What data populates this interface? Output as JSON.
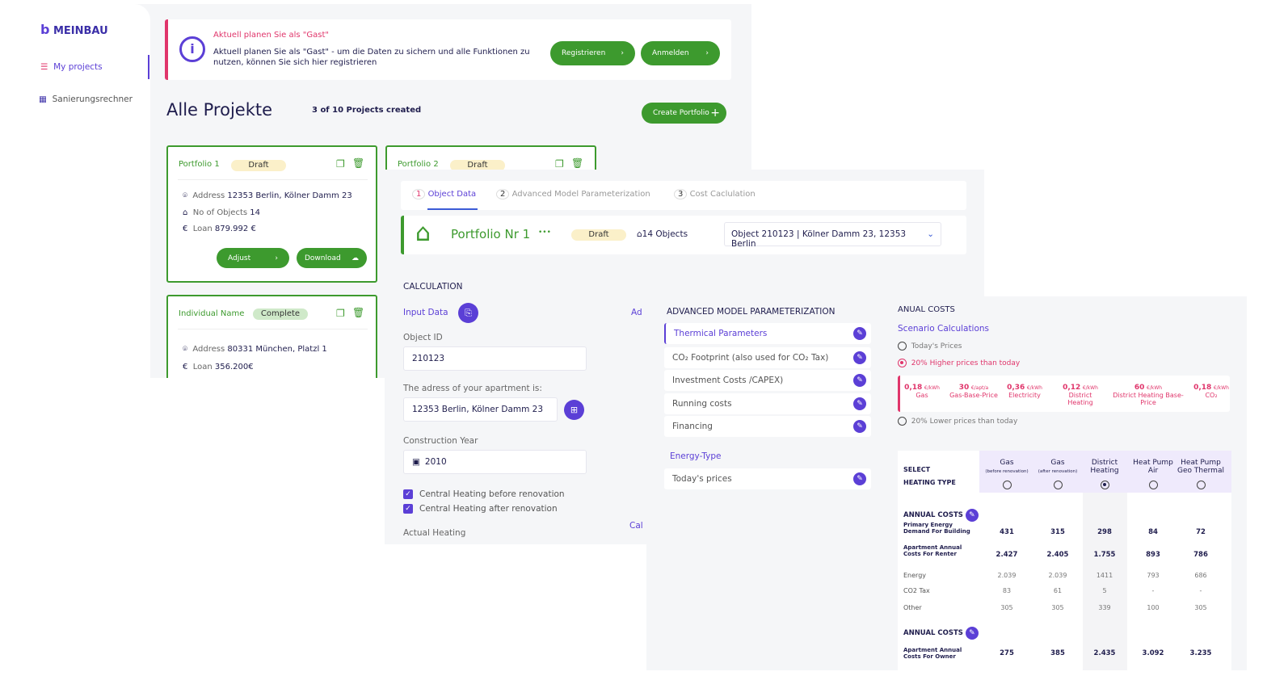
{
  "colors": {
    "green": "#3d9a2e",
    "purple": "#5b3fd6",
    "pink": "#e0356b",
    "navy": "#1f1d4d"
  },
  "sidebar": {
    "logo": "MEINBAU",
    "items": [
      {
        "label": "My projects",
        "icon": "list-icon",
        "active": true
      },
      {
        "label": "Sanierungsrechner",
        "icon": "calculator-icon"
      }
    ]
  },
  "banner": {
    "title": "Aktuell planen Sie als \"Gast\"",
    "text": "Aktuell planen Sie als \"Gast\" - um die Daten zu sichern und alle Funktionen zu nutzen, können Sie sich hier registrieren",
    "register": "Registrieren",
    "login": "Anmelden"
  },
  "projects": {
    "title": "Alle Projekte",
    "count": "3 of 10 Projects created",
    "create": "Create Portfolio",
    "cards": [
      {
        "name": "Portfolio 1",
        "status": "Draft",
        "address_label": "Address",
        "address": "12353 Berlin, Kölner Damm 23",
        "objects_label": "No of Objects",
        "objects": "14",
        "loan_label": "Loan",
        "loan": "879.992 €",
        "adjust": "Adjust",
        "download": "Download"
      },
      {
        "name": "Portfolio 2",
        "status": "Draft"
      },
      {
        "name": "Individual Name",
        "status": "Complete",
        "address_label": "Address",
        "address": "80331 München, Platzl 1",
        "loan_label": "Loan",
        "loan": "356.200€"
      }
    ]
  },
  "wizard": {
    "steps": [
      {
        "num": "1",
        "label": "Object Data",
        "active": true
      },
      {
        "num": "2",
        "label": "Advanced Model Parameterization"
      },
      {
        "num": "3",
        "label": "Cost Caclulation"
      }
    ],
    "portfolio": "Portfolio Nr 1",
    "more": "•••",
    "status": "Draft",
    "objects": "14 Objects",
    "object_select": "Object 210123 | Kölner Damm 23, 12353 Berlin",
    "section": "CALCULATION",
    "input_data": "Input Data",
    "ad_cut": "Ad",
    "cal_cut": "Cal",
    "object_id_label": "Object ID",
    "object_id": "210123",
    "address_label": "The adress of your apartment is:",
    "address": "12353 Berlin, Kölner Damm 23",
    "year_label": "Construction Year",
    "year": "2010",
    "checks": [
      {
        "label": "Central Heating before renovation",
        "checked": true
      },
      {
        "label": "Central Heating after renovation",
        "checked": true
      }
    ],
    "actual_heating": "Actual Heating"
  },
  "advanced": {
    "title": "ADVANCED MODEL PARAMETERIZATION",
    "items": [
      "Thermical  Parameters",
      "CO₂  Footprint (also used for CO₂ Tax)",
      "Investment Costs /CAPEX)",
      "Running costs",
      "Financing"
    ],
    "energy_title": "Energy-Type",
    "energy_item": "Today's prices"
  },
  "costs": {
    "title": "ANUAL COSTS",
    "scenario": "Scenario Calculations",
    "options": [
      {
        "label": "Today's Prices",
        "selected": false
      },
      {
        "label": "20% Higher prices than today",
        "selected": true
      },
      {
        "label": "20% Lower prices than today",
        "selected": false
      }
    ],
    "prices": [
      {
        "value": "0,18",
        "unit": "€/kWh",
        "label": "Gas"
      },
      {
        "value": "30",
        "unit": "€/apt/a",
        "label": "Gas-Base-Price"
      },
      {
        "value": "0,36",
        "unit": "€/kWh",
        "label": "Electricity"
      },
      {
        "value": "0,12",
        "unit": "€/kWh",
        "label": "District Heating"
      },
      {
        "value": "60",
        "unit": "€/kWh",
        "label": "District Heating Base-Price"
      },
      {
        "value": "0,18",
        "unit": "€/kWh",
        "label": "CO₂"
      }
    ],
    "select_label": [
      "SELECT",
      "HEATING TYPE"
    ],
    "types": [
      {
        "name": "Gas",
        "sub": "(before renovation)"
      },
      {
        "name": "Gas",
        "sub": "(after renovation)"
      },
      {
        "name": "District Heating",
        "sub": "",
        "selected": true
      },
      {
        "name": "Heat Pump Air",
        "sub": ""
      },
      {
        "name": "Heat Pump Geo Thermal",
        "sub": ""
      }
    ],
    "section1": "ANNUAL COSTS",
    "section2": "ANNUAL COSTS",
    "rows": [
      {
        "label": "Primary Energy Demand For Building",
        "bold": true,
        "values": [
          "431",
          "315",
          "298",
          "84",
          "72"
        ]
      },
      {
        "label": "Apartment Annual Costs For Renter",
        "bold": true,
        "values": [
          "2.427",
          "2.405",
          "1.755",
          "893",
          "786"
        ]
      },
      {
        "label": "Energy",
        "values": [
          "2.039",
          "2.039",
          "1411",
          "793",
          "686"
        ]
      },
      {
        "label": "CO2 Tax",
        "values": [
          "83",
          "61",
          "5",
          "-",
          "-"
        ]
      },
      {
        "label": "Other",
        "values": [
          "305",
          "305",
          "339",
          "100",
          "305"
        ]
      }
    ],
    "owner_row": {
      "label": "Apartment Annual Costs For Owner",
      "values": [
        "275",
        "385",
        "2.435",
        "3.092",
        "3.235"
      ]
    }
  }
}
